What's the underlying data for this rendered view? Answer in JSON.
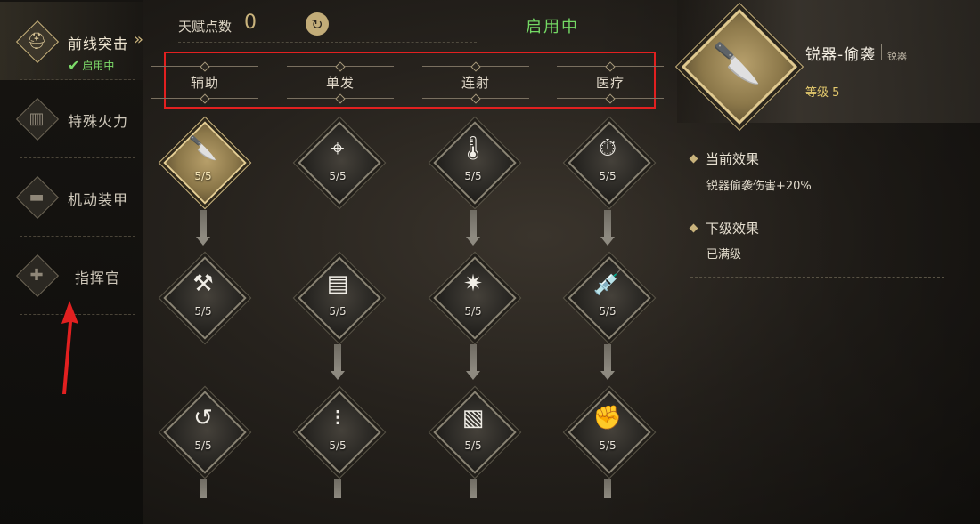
{
  "sidebar": {
    "categories": [
      {
        "label": "前线突击",
        "status": "启用中",
        "icon": "helmet-icon"
      },
      {
        "label": "特殊火力",
        "icon": "vest-icon"
      },
      {
        "label": "机动装甲",
        "icon": "tank-icon"
      },
      {
        "label": "指挥官",
        "icon": "medkit-icon"
      }
    ]
  },
  "topbar": {
    "points_label": "天赋点数",
    "points_value": "0",
    "status": "启用中"
  },
  "columns": [
    "辅助",
    "单发",
    "连射",
    "医疗"
  ],
  "talents": [
    {
      "icon": "knife-icon",
      "level": "5/5",
      "selected": true
    },
    {
      "icon": "crosshair-gun-icon",
      "level": "5/5"
    },
    {
      "icon": "gun-thermometer-icon",
      "level": "5/5"
    },
    {
      "icon": "timer-up-icon",
      "level": "5/5"
    },
    {
      "icon": "hammer-wrench-up-icon",
      "level": "5/5"
    },
    {
      "icon": "ammo-belt-icon",
      "level": "5/5"
    },
    {
      "icon": "gun-burst-icon",
      "level": "5/5"
    },
    {
      "icon": "syringe-rank-icon",
      "level": "5/5"
    },
    {
      "icon": "reload-hand-icon",
      "level": "5/5"
    },
    {
      "icon": "bullets-icon",
      "level": "5/5"
    },
    {
      "icon": "magazine-icon",
      "level": "5/5"
    },
    {
      "icon": "bandaged-arm-icon",
      "level": "5/5"
    }
  ],
  "detail": {
    "name": "锐器-偷袭",
    "type": "锐器",
    "level": "等级 5",
    "current_title": "当前效果",
    "current_text": "锐器偷袭伤害+20%",
    "next_title": "下级效果",
    "next_text": "已满级"
  },
  "colors": {
    "accent": "#c9b37c",
    "active_green": "#74d964",
    "annotation_red": "#e22020"
  }
}
